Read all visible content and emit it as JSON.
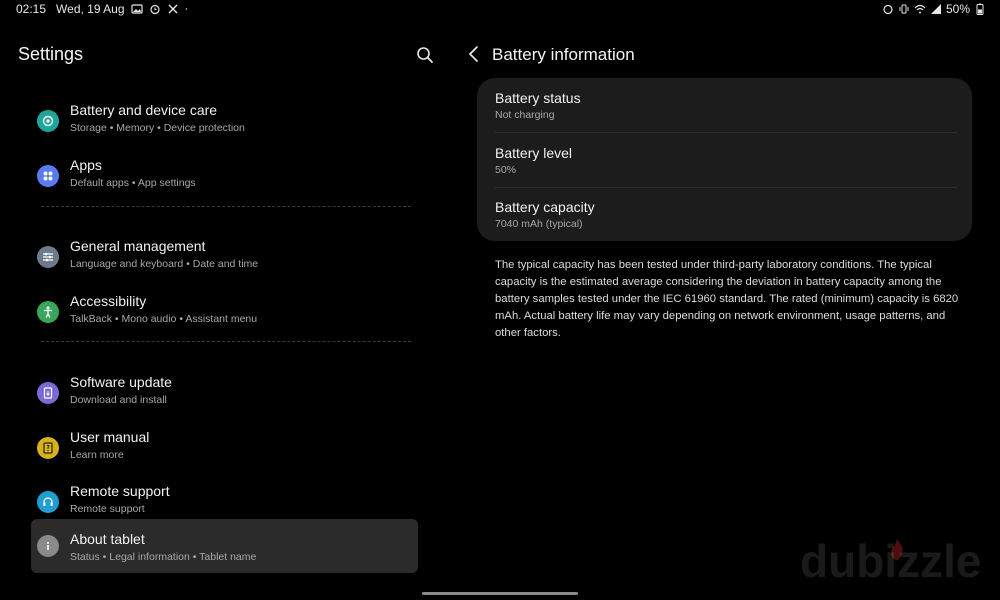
{
  "status_bar": {
    "time": "02:15",
    "date": "Wed, 19 Aug",
    "battery_percent": "50%",
    "left_icons": [
      "gallery-icon",
      "alarm-icon",
      "tools-icon",
      "dot-icon"
    ],
    "right_icons": [
      "alarm-icon",
      "vibrate-icon",
      "wifi-icon",
      "signal-icon",
      "battery-icon"
    ]
  },
  "left_panel": {
    "title": "Settings",
    "items": [
      {
        "title": "Battery and device care",
        "subtitle": "Storage  •  Memory  •  Device protection",
        "icon": "device-care-icon",
        "color": "#1ea69a"
      },
      {
        "title": "Apps",
        "subtitle": "Default apps  •  App settings",
        "icon": "apps-icon",
        "color": "#5b7cf0"
      },
      {
        "title": "General management",
        "subtitle": "Language and keyboard  •  Date and time",
        "icon": "sliders-icon",
        "color": "#6c7a8a"
      },
      {
        "title": "Accessibility",
        "subtitle": "TalkBack  •  Mono audio  •  Assistant menu",
        "icon": "accessibility-icon",
        "color": "#3aa65a"
      },
      {
        "title": "Software update",
        "subtitle": "Download and install",
        "icon": "software-update-icon",
        "color": "#7a6ad8"
      },
      {
        "title": "User manual",
        "subtitle": "Learn more",
        "icon": "manual-icon",
        "color": "#d8b21a"
      },
      {
        "title": "Remote support",
        "subtitle": "Remote support",
        "icon": "headset-icon",
        "color": "#1e9fd0"
      },
      {
        "title": "About tablet",
        "subtitle": "Status  •  Legal information  •  Tablet name",
        "icon": "info-icon",
        "color": "#8a8a8a"
      }
    ]
  },
  "right_panel": {
    "title": "Battery information",
    "rows": [
      {
        "title": "Battery status",
        "value": "Not charging"
      },
      {
        "title": "Battery level",
        "value": "50%"
      },
      {
        "title": "Battery capacity",
        "value": "7040 mAh (typical)"
      }
    ],
    "note": "The typical capacity has been tested under third-party laboratory conditions. The typical capacity is the estimated average considering the deviation in battery capacity among the battery samples tested under the IEC 61960 standard. The rated (minimum) capacity is 6820 mAh. Actual battery life may vary depending on network environment, usage patterns, and other factors."
  },
  "watermark": "dubizzle"
}
